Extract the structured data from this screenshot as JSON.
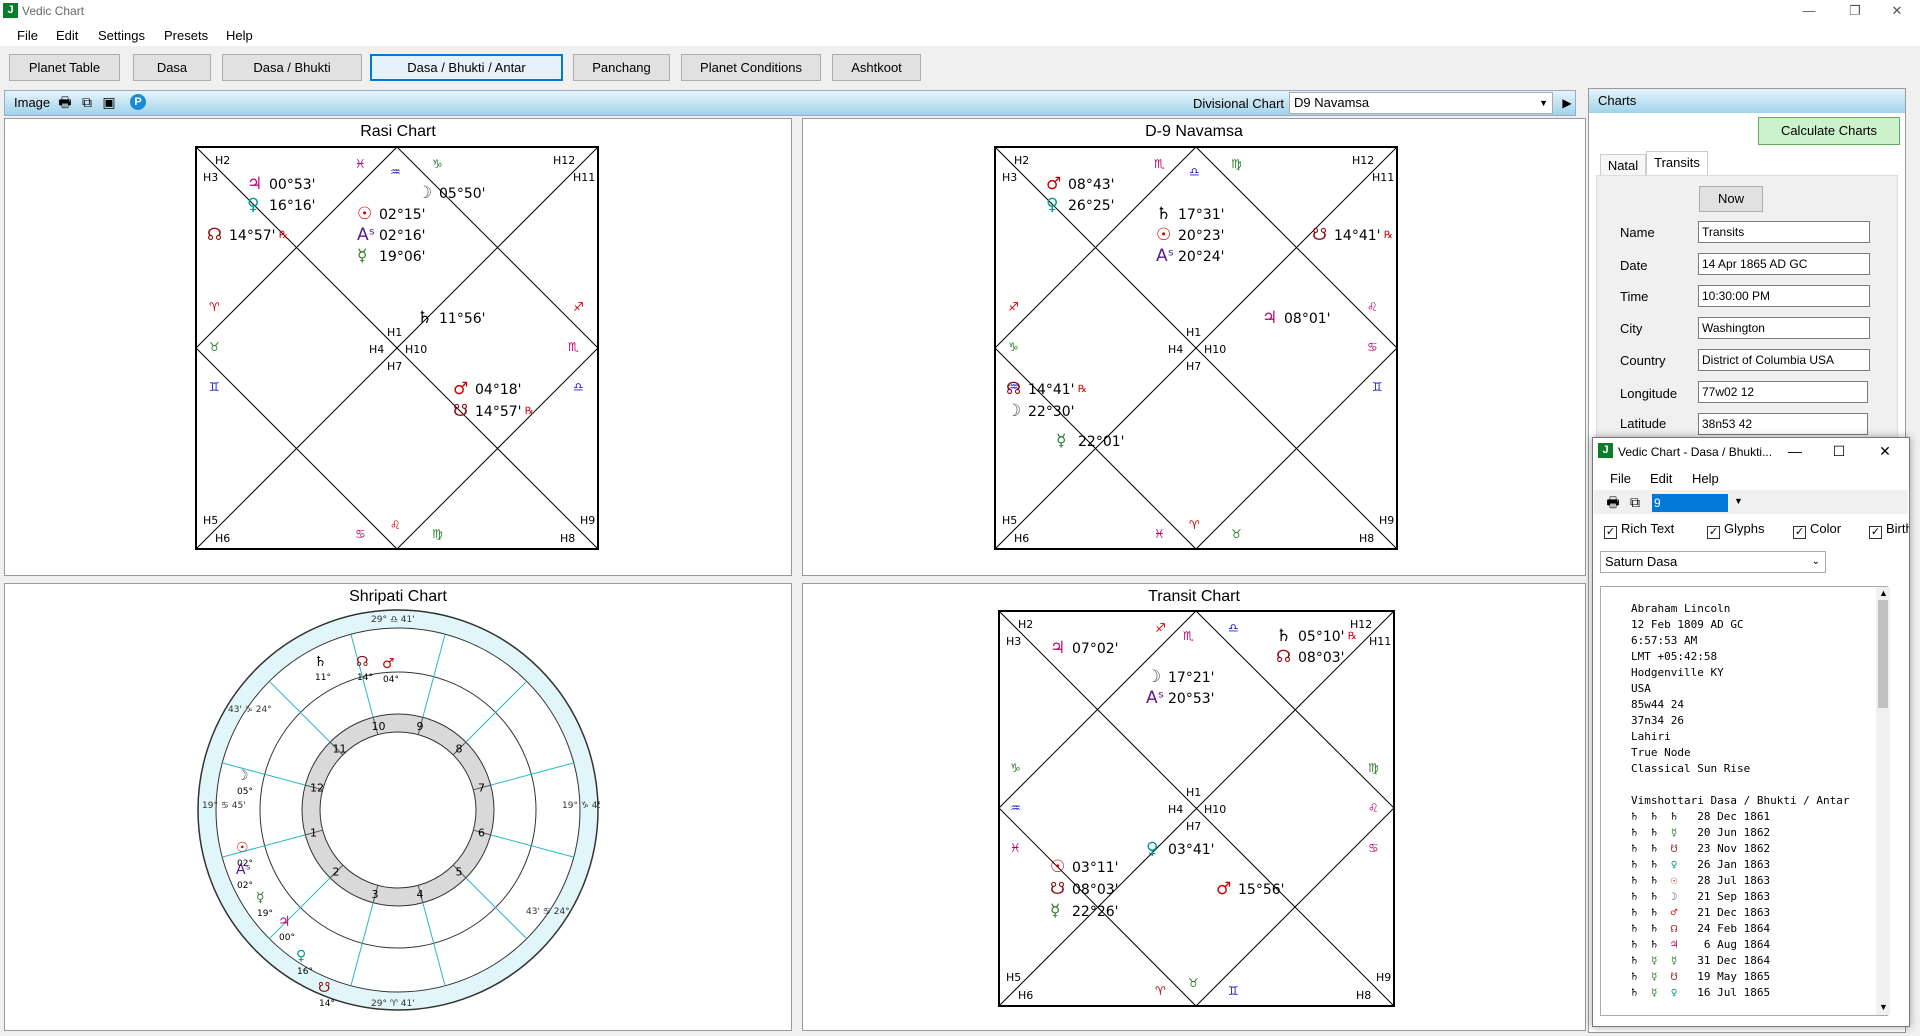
{
  "window": {
    "title": "Vedic Chart",
    "icon": "J",
    "min": "—",
    "max": "❐",
    "close": "✕"
  },
  "menu": [
    "File",
    "Edit",
    "Settings",
    "Presets",
    "Help"
  ],
  "toolbar": [
    "Planet Table",
    "Dasa",
    "Dasa / Bhukti",
    "Dasa / Bhukti / Antar",
    "Panchang",
    "Planet Conditions",
    "Ashtkoot"
  ],
  "active_toolbar": "Dasa / Bhukti / Antar",
  "chart_header": {
    "image_label": "Image",
    "divisional_label": "Divisional Chart",
    "divisional_value": "D9 Navamsa"
  },
  "rasi": {
    "title": "Rasi Chart",
    "houses": {
      "H1": "H1",
      "H2": "H2",
      "H3": "H3",
      "H4": "H4",
      "H5": "H5",
      "H6": "H6",
      "H7": "H7",
      "H8": "H8",
      "H9": "H9",
      "H10": "H10",
      "H11": "H11",
      "H12": "H12"
    },
    "planets": [
      {
        "g": "♃",
        "d": "00°53'",
        "c": "#c0006a"
      },
      {
        "g": "♀",
        "d": "16°16'",
        "c": "#009c8c"
      },
      {
        "g": "☊",
        "d": "14°57'",
        "c": "#8b1010",
        "r": "℞"
      },
      {
        "g": "☉",
        "d": "02°15'",
        "c": "#d10000"
      },
      {
        "g": "Aˢ",
        "d": "02°16'",
        "c": "#5a1a8a"
      },
      {
        "g": "☿",
        "d": "19°06'",
        "c": "#2a7a2a"
      },
      {
        "g": "☽",
        "d": "05°50'",
        "c": "#555"
      },
      {
        "g": "♄",
        "d": "11°56'",
        "c": "#000"
      },
      {
        "g": "♂",
        "d": "04°18'",
        "c": "#d10000"
      },
      {
        "g": "☋",
        "d": "14°57'",
        "c": "#8b1010",
        "r": "℞"
      }
    ],
    "signs": [
      "♓",
      "♒",
      "♑",
      "♈",
      "♉",
      "♊",
      "♐",
      "♏",
      "♎",
      "♋",
      "♌",
      "♍"
    ]
  },
  "navamsa": {
    "title": "D-9 Navamsa",
    "planets": [
      {
        "g": "♂",
        "d": "08°43'",
        "c": "#d10000"
      },
      {
        "g": "♀",
        "d": "26°25'",
        "c": "#009c8c"
      },
      {
        "g": "♄",
        "d": "17°31'",
        "c": "#000"
      },
      {
        "g": "☉",
        "d": "20°23'",
        "c": "#d10000"
      },
      {
        "g": "Aˢ",
        "d": "20°24'",
        "c": "#5a1a8a"
      },
      {
        "g": "☋",
        "d": "14°41'",
        "c": "#8b1010",
        "r": "℞"
      },
      {
        "g": "♃",
        "d": "08°01'",
        "c": "#c0006a"
      },
      {
        "g": "☊",
        "d": "14°41'",
        "c": "#8b1010",
        "r": "℞"
      },
      {
        "g": "☽",
        "d": "22°30'",
        "c": "#555"
      },
      {
        "g": "☿",
        "d": "22°01'",
        "c": "#2a7a2a"
      }
    ],
    "signs": [
      "♏",
      "♍",
      "♎",
      "♌",
      "♐",
      "♑",
      "♋",
      "♒",
      "♊",
      "♓",
      "♈",
      "♉"
    ]
  },
  "shripati": {
    "title": "Shripati Chart",
    "numbers": [
      "10",
      "9",
      "8",
      "7",
      "6",
      "5",
      "4",
      "3",
      "2",
      "1",
      "12",
      "11"
    ],
    "outer": [
      "29° ♎ 41'",
      "29° ♈ 41'",
      "19° ♋ 45'",
      "19° ♑ 45'",
      "43' ♑ 24°",
      "43' ♋ 24°"
    ],
    "inner_labels": [
      {
        "g": "♄",
        "l": "11°",
        "c": "#000"
      },
      {
        "g": "☊",
        "l": "14°",
        "c": "#8b1010"
      },
      {
        "g": "♂",
        "l": "04°",
        "c": "#d10000"
      },
      {
        "g": "☽",
        "l": "05°",
        "c": "#555"
      },
      {
        "g": "☉",
        "l": "02°",
        "c": "#d10000"
      },
      {
        "g": "Aˢ",
        "l": "02°",
        "c": "#5a1a8a"
      },
      {
        "g": "☿",
        "l": "19°",
        "c": "#2a7a2a"
      },
      {
        "g": "♃",
        "l": "00°",
        "c": "#c0006a"
      },
      {
        "g": "♀",
        "l": "16°",
        "c": "#009c8c"
      },
      {
        "g": "☋",
        "l": "14°",
        "c": "#8b1010"
      }
    ]
  },
  "transit": {
    "title": "Transit Chart",
    "planets": [
      {
        "g": "♃",
        "d": "07°02'",
        "c": "#c0006a"
      },
      {
        "g": "♄",
        "d": "05°10'",
        "c": "#000",
        "r": "℞"
      },
      {
        "g": "☊",
        "d": "08°03'",
        "c": "#8b1010"
      },
      {
        "g": "☽",
        "d": "17°21'",
        "c": "#555"
      },
      {
        "g": "Aˢ",
        "d": "20°53'",
        "c": "#5a1a8a"
      },
      {
        "g": "♀",
        "d": "03°41'",
        "c": "#009c8c"
      },
      {
        "g": "☉",
        "d": "03°11'",
        "c": "#d10000"
      },
      {
        "g": "☋",
        "d": "08°03'",
        "c": "#8b1010"
      },
      {
        "g": "☿",
        "d": "22°26'",
        "c": "#2a7a2a"
      },
      {
        "g": "♂",
        "d": "15°56'",
        "c": "#d10000"
      }
    ],
    "signs": [
      "♐",
      "♏",
      "♎",
      "♍",
      "♑",
      "♒",
      "♌",
      "♋",
      "♓",
      "♈",
      "♉",
      "♊"
    ]
  },
  "charts_panel": {
    "title": "Charts",
    "calc_label": "Calculate Charts",
    "tabs": [
      "Natal",
      "Transits"
    ],
    "now_label": "Now",
    "fields": [
      {
        "label": "Name",
        "value": "Transits"
      },
      {
        "label": "Date",
        "value": "14 Apr 1865 AD GC"
      },
      {
        "label": "Time",
        "value": "10:30:00 PM"
      },
      {
        "label": "City",
        "value": "Washington"
      },
      {
        "label": "Country",
        "value": "District of Columbia USA"
      },
      {
        "label": "Longitude",
        "value": "77w02 12"
      },
      {
        "label": "Latitude",
        "value": "38n53 42"
      }
    ]
  },
  "dasa_window": {
    "title": "Vedic Chart - Dasa / Bhukti...",
    "menu": [
      "File",
      "Edit",
      "Help"
    ],
    "page": "9",
    "checks": [
      "Rich Text",
      "Glyphs",
      "Color",
      "Birth"
    ],
    "select": "Saturn Dasa",
    "header_lines": [
      "Abraham Lincoln",
      "12 Feb 1809 AD GC",
      "6:57:53 AM",
      "LMT +05:42:58",
      "Hodgenville KY",
      "USA",
      "85w44 24",
      "37n34 26",
      "Lahiri",
      "True Node",
      "Classical Sun Rise",
      "",
      "Vimshottari Dasa / Bhukti / Antar"
    ],
    "rows": [
      {
        "a": "♄",
        "b": "♄",
        "c": "♄",
        "d": "28 Dec 1861"
      },
      {
        "a": "♄",
        "b": "♄",
        "c": "☿",
        "d": "20 Jun 1862"
      },
      {
        "a": "♄",
        "b": "♄",
        "c": "☋",
        "d": "23 Nov 1862"
      },
      {
        "a": "♄",
        "b": "♄",
        "c": "♀",
        "d": "26 Jan 1863"
      },
      {
        "a": "♄",
        "b": "♄",
        "c": "☉",
        "d": "28 Jul 1863"
      },
      {
        "a": "♄",
        "b": "♄",
        "c": "☽",
        "d": "21 Sep 1863"
      },
      {
        "a": "♄",
        "b": "♄",
        "c": "♂",
        "d": "21 Dec 1863"
      },
      {
        "a": "♄",
        "b": "♄",
        "c": "☊",
        "d": "24 Feb 1864"
      },
      {
        "a": "♄",
        "b": "♄",
        "c": "♃",
        "d": " 6 Aug 1864"
      },
      {
        "a": "♄",
        "b": "☿",
        "c": "☿",
        "d": "31 Dec 1864"
      },
      {
        "a": "♄",
        "b": "☿",
        "c": "☋",
        "d": "19 May 1865"
      },
      {
        "a": "♄",
        "b": "☿",
        "c": "♀",
        "d": "16 Jul 1865"
      }
    ]
  }
}
